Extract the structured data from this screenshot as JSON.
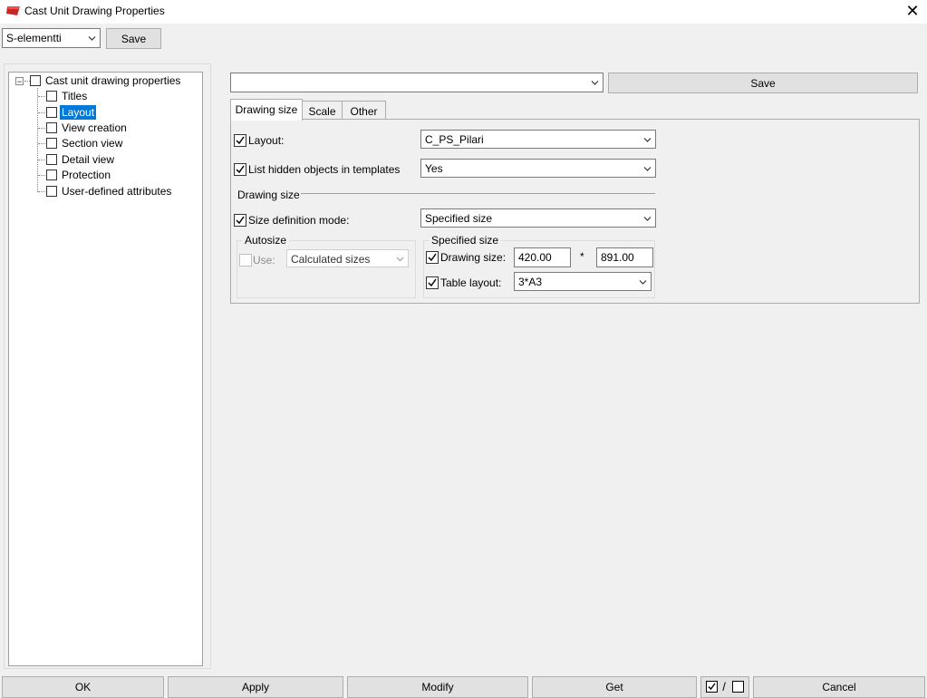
{
  "window": {
    "title": "Cast Unit Drawing Properties"
  },
  "topbar": {
    "preset_value": "S-elementti",
    "save_label": "Save"
  },
  "tree": {
    "root": "Cast unit drawing properties",
    "items": [
      "Titles",
      "Layout",
      "View creation",
      "Section view",
      "Detail view",
      "Protection",
      "User-defined attributes"
    ],
    "selected": "Layout"
  },
  "settings_bar": {
    "preset_value": "",
    "save_label": "Save"
  },
  "tabs": [
    {
      "label": "Drawing size",
      "active": true
    },
    {
      "label": "Scale",
      "active": false
    },
    {
      "label": "Other",
      "active": false
    }
  ],
  "drawing_size_tab": {
    "layout": {
      "label": "Layout:",
      "value": "C_PS_Pilari",
      "checked": true
    },
    "list_hidden": {
      "label": "List hidden objects in templates",
      "value": "Yes",
      "checked": true
    },
    "section_title": "Drawing size",
    "size_mode": {
      "label": "Size definition mode:",
      "value": "Specified size",
      "checked": true
    },
    "autosize": {
      "title": "Autosize",
      "use_label": "Use:",
      "use_value": "Calculated sizes",
      "checked": false
    },
    "specified": {
      "title": "Specified size",
      "drawing_size_label": "Drawing size:",
      "width": "420.00",
      "separator": "*",
      "height": "891.00",
      "table_layout_label": "Table layout:",
      "table_layout_value": "3*A3",
      "checked": true
    }
  },
  "footer": {
    "ok": "OK",
    "apply": "Apply",
    "modify": "Modify",
    "get": "Get",
    "toggle_separator": "/",
    "cancel": "Cancel"
  },
  "colors": {
    "selection": "#0078d7",
    "app_icon": "#c62828"
  },
  "icons": {
    "app": "tekla-app-icon",
    "close": "close-icon",
    "dropdown": "chevron-down-icon",
    "check": "check-icon"
  }
}
